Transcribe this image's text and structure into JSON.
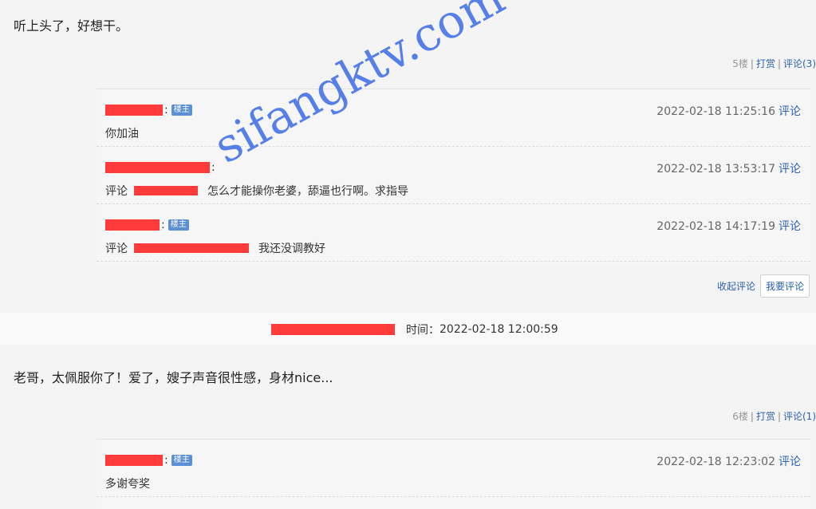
{
  "post1": {
    "text": "听上头了，好想干。",
    "floor": "5楼",
    "tip": "打赏",
    "comment": "评论(3)",
    "replies": [
      {
        "badge": "楼主",
        "time": "2022-02-18 11:25:16",
        "action": "评论",
        "body": "你加油",
        "prefix": ""
      },
      {
        "badge": "",
        "time": "2022-02-18 13:53:17",
        "action": "评论",
        "prefix": "评论",
        "body": "怎么才能操你老婆，舔逼也行啊。求指导"
      },
      {
        "badge": "楼主",
        "time": "2022-02-18 14:17:19",
        "action": "评论",
        "prefix": "评论",
        "body": "我还没调教好"
      }
    ],
    "collapse": "收起评论",
    "write_comment": "我要评论"
  },
  "timebar": {
    "label": "时间：",
    "value": "2022-02-18 12:00:59"
  },
  "post2": {
    "text": "老哥，太佩服你了！爱了，嫂子声音很性感，身材nice...",
    "floor": "6楼",
    "tip": "打赏",
    "comment": "评论(1)",
    "replies": [
      {
        "badge": "楼主",
        "time": "2022-02-18 12:23:02",
        "action": "评论",
        "body": "多谢夸奖"
      }
    ]
  },
  "watermark": "sifangktv.com",
  "colors": {
    "link": "#2c62b0",
    "badge": "#5b8fd6",
    "redact": "#ff3b3b",
    "watermark": "#4f79e8"
  }
}
